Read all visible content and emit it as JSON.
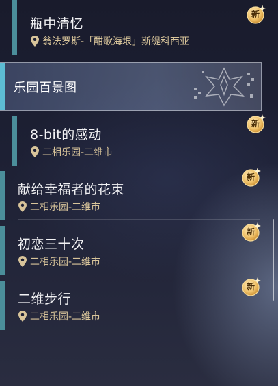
{
  "new_badge_label": "新",
  "group_header": {
    "title": "乐园百景图"
  },
  "items": [
    {
      "title": "瓶中清忆",
      "location": "翁法罗斯-「酣歌海垠」斯缇科西亚"
    },
    {
      "title": "8-bit的感动",
      "location": "二相乐园-二维市"
    },
    {
      "title": "献给幸福者的花束",
      "location": "二相乐园-二维市"
    },
    {
      "title": "初恋三十次",
      "location": "二相乐园-二维市"
    },
    {
      "title": "二维步行",
      "location": "二相乐园-二维市"
    }
  ],
  "colors": {
    "accent_teal": "#4b8e9a",
    "header_accent": "#5dbcd3",
    "location_gold": "#d8c49a",
    "badge_gold": "#e6b95a"
  }
}
